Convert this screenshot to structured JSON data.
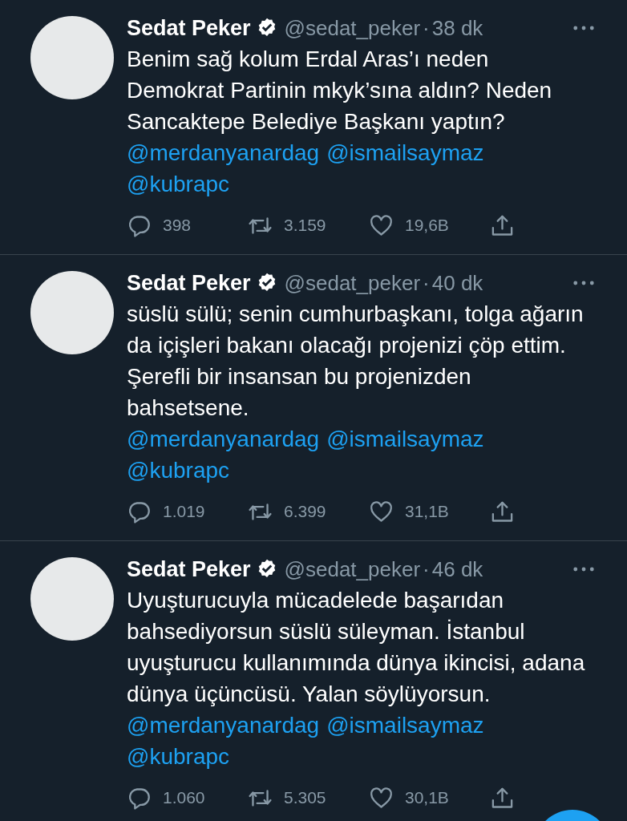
{
  "tweets": [
    {
      "name": "Sedat Peker",
      "verified": true,
      "handle": "@sedat_peker",
      "separator": "·",
      "time": "38 dk",
      "text": "Benim sağ kolum Erdal Aras’ı neden Demokrat Partinin mkyk’sına aldın? Neden Sancaktepe Belediye Başkanı yaptın?",
      "mentions": [
        "@merdanyanardag",
        "@ismailsaymaz",
        "@kubrapc"
      ],
      "replies": "398",
      "retweets": "3.159",
      "likes": "19,6B"
    },
    {
      "name": "Sedat Peker",
      "verified": true,
      "handle": "@sedat_peker",
      "separator": "·",
      "time": "40 dk",
      "text": "süslü sülü; senin cumhurbaşkanı, tolga ağarın da içişleri bakanı olacağı projenizi çöp ettim. Şerefli bir insansan bu projenizden bahsetsene.",
      "mentions": [
        "@merdanyanardag",
        "@ismailsaymaz",
        "@kubrapc"
      ],
      "replies": "1.019",
      "retweets": "6.399",
      "likes": "31,1B"
    },
    {
      "name": "Sedat Peker",
      "verified": true,
      "handle": "@sedat_peker",
      "separator": "·",
      "time": "46 dk",
      "text": "Uyuşturucuyla mücadelede başarıdan bahsediyorsun süslü süleyman. İstanbul uyuşturucu kullanımında dünya ikincisi, adana dünya üçüncüsü. Yalan söylüyorsun.",
      "mentions": [
        "@merdanyanardag",
        "@ismailsaymaz",
        "@kubrapc"
      ],
      "replies": "1.060",
      "retweets": "5.305",
      "likes": "30,1B"
    }
  ]
}
